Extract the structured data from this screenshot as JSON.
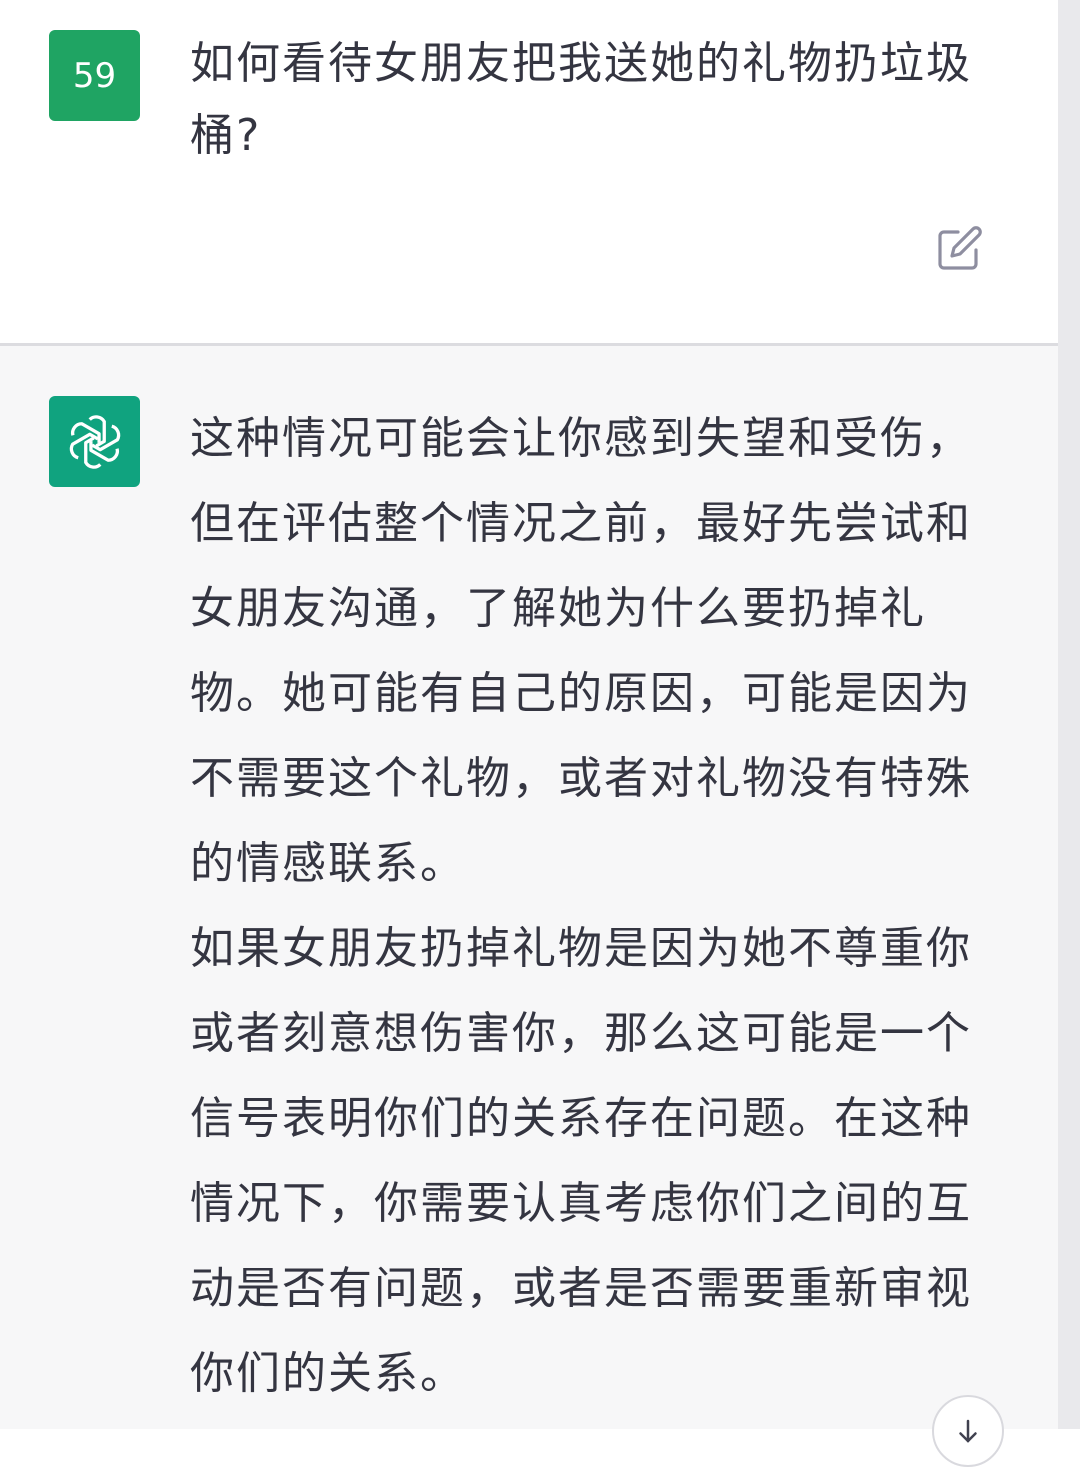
{
  "user_message": {
    "avatar_text": "59",
    "text": "如何看待女朋友把我送她的礼物扔垃圾桶?",
    "edit_icon": "edit-icon"
  },
  "assistant_message": {
    "avatar_icon": "openai-logo-icon",
    "paragraphs": [
      "这种情况可能会让你感到失望和受伤，但在评估整个情况之前，最好先尝试和女朋友沟通，了解她为什么要扔掉礼物。她可能有自己的原因，可能是因为不需要这个礼物，或者对礼物没有特殊的情感联系。",
      "如果女朋友扔掉礼物是因为她不尊重你或者刻意想伤害你，那么这可能是一个信号表明你们的关系存在问题。在这种情况下，你需要认真考虑你们之间的互动是否有问题，或者是否需要重新审视你们的关系。"
    ]
  },
  "colors": {
    "user_avatar": "#1fa463",
    "assistant_avatar": "#10a37f",
    "assistant_background": "#f7f7f8",
    "text": "#343541"
  },
  "scroll_button_icon": "arrow-down-icon"
}
